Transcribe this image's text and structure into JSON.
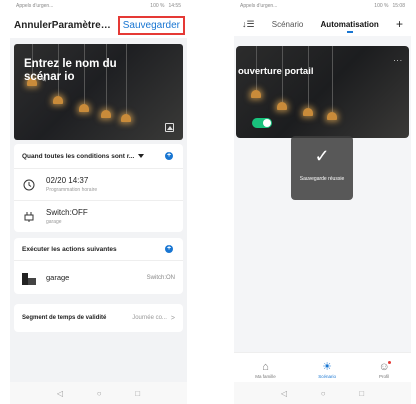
{
  "left": {
    "status": {
      "carrier": "Appels d'urgen...",
      "battery": "100 %",
      "time": "14:55"
    },
    "header": {
      "cancel": "Annuler",
      "title": "Paramètres d'auto...",
      "save": "Sauvegarder"
    },
    "hero": {
      "title": "Entrez le nom du scénar io",
      "edit_icon": "✎"
    },
    "conditions": {
      "heading": "Quand toutes les conditions sont r...",
      "items": [
        {
          "icon": "clock-icon",
          "main": "02/20 14:37",
          "sub": "Programmation horaire"
        },
        {
          "icon": "plug-icon",
          "main": "Switch:OFF",
          "sub": "garage"
        }
      ]
    },
    "actions": {
      "heading": "Exécuter les actions suivantes",
      "items": [
        {
          "icon": "garage-icon",
          "name": "garage",
          "state": "Switch:ON"
        }
      ]
    },
    "segment": {
      "label": "Segment de temps de validité",
      "value": "Journée co...",
      "chevron": ">"
    }
  },
  "right": {
    "status": {
      "carrier": "Appels d'urgen...",
      "battery": "100 %",
      "time": "15:08"
    },
    "header": {
      "list_icon": "↓☰",
      "tab1": "Scénario",
      "tab2": "Automatisation",
      "plus": "+"
    },
    "card": {
      "title": "ouverture portail",
      "menu": "...",
      "toggle_on": true
    },
    "toast": {
      "check": "✓",
      "message": "Sauvegarde réussie"
    },
    "tabbar": [
      {
        "icon": "home-icon",
        "glyph": "⌂",
        "label": "Ma famille"
      },
      {
        "icon": "sun-icon",
        "glyph": "☀",
        "label": "Scénario"
      },
      {
        "icon": "profile-icon",
        "glyph": "☺",
        "label": "Profil"
      }
    ]
  },
  "navbar": {
    "back": "◁",
    "home": "○",
    "recent": "□"
  }
}
